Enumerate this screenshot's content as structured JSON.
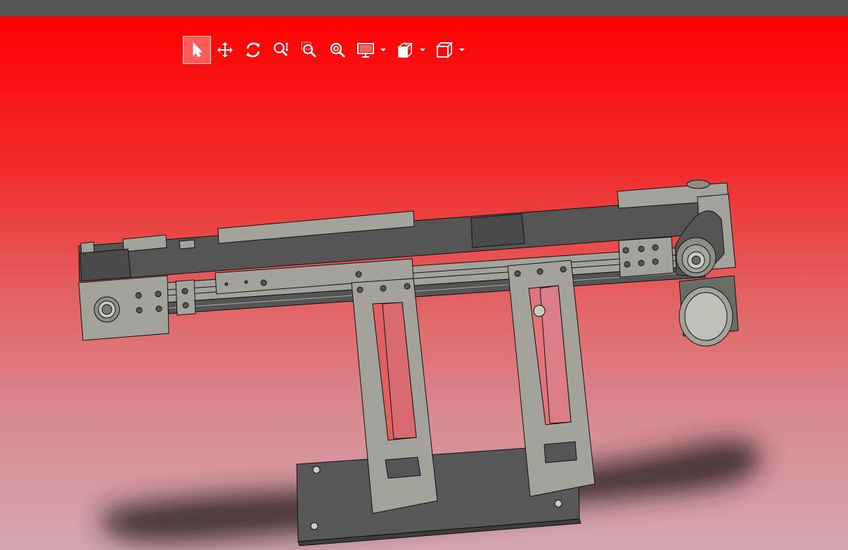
{
  "toolbar": {
    "items": [
      {
        "id": "select",
        "icon": "select-arrow-icon",
        "active": true
      },
      {
        "id": "pan",
        "icon": "pan-move-icon",
        "active": false
      },
      {
        "id": "rotate",
        "icon": "rotate-icon",
        "active": false
      },
      {
        "id": "zoom",
        "icon": "zoom-icon",
        "active": false
      },
      {
        "id": "zoom-window",
        "icon": "zoom-window-icon",
        "active": false
      },
      {
        "id": "zoom-fit",
        "icon": "zoom-fit-icon",
        "active": false
      },
      {
        "id": "display-mode",
        "icon": "display-monitor-icon",
        "dropdown": true
      },
      {
        "id": "section-view",
        "icon": "section-view-icon",
        "dropdown": true
      },
      {
        "id": "view-orientation",
        "icon": "view-cube-icon",
        "dropdown": true
      }
    ]
  },
  "colors": {
    "topbar": "#555555",
    "background_top": "#ff0000",
    "background_bottom": "#d4a6b0",
    "toolbar_icon": "#ffffff",
    "active_button": "#ff5b5b",
    "part_light": "#a3a39b",
    "part_dark": "#575757"
  }
}
